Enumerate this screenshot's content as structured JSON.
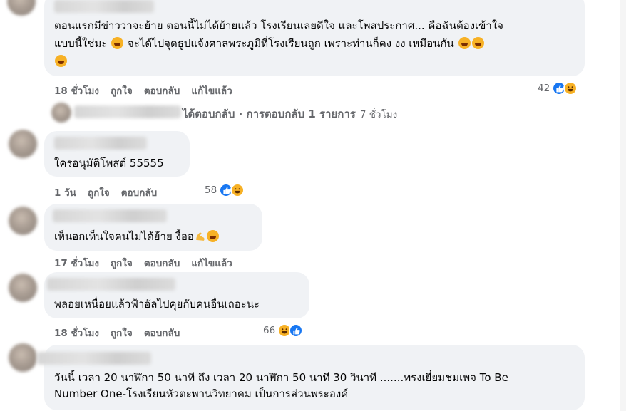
{
  "comments": [
    {
      "text_line1": "ตอนแรกมีข่าวว่าจะย้าย ตอนนี้ไม่ได้ย้ายแล้ว โรงเรียนเลยดีใจ และโพสประกาศ... คือฉันต้องเข้าใจ",
      "text_line2a": "แบบนี้ใช่มะ",
      "text_line2b": "จะได้ไปจุดธูปแจ้งศาลพระภูมิที่โรงเรียนถูก เพราะท่านก็คง งง เหมือนกัน",
      "time": "18 ชั่วโมง",
      "like": "ถูกใจ",
      "reply": "ตอบกลับ",
      "edited": "แก้ไขแล้ว",
      "reaction_count": "42"
    },
    {
      "text": "ใครอนุมัติโพสต์ 55555",
      "time": "1 วัน",
      "like": "ถูกใจ",
      "reply": "ตอบกลับ",
      "reaction_count": "58"
    },
    {
      "text": "เห็นอกเห็นใจคนไม่ได้ย้าย งื้ออ",
      "time": "17 ชั่วโมง",
      "like": "ถูกใจ",
      "reply": "ตอบกลับ",
      "edited": "แก้ไขแล้ว"
    },
    {
      "text": "พลอยเหนื่อยแล้วฟ้าอัลไปคุยกับคนอื่นเถอะนะ",
      "time": "18 ชั่วโมง",
      "like": "ถูกใจ",
      "reply": "ตอบกลับ",
      "reaction_count": "66"
    },
    {
      "text_line1": "วันนี้ เวลา 20 นาฬิกา 50 นาที ถึง เวลา 20 นาฬิกา 50 นาที 30 วินาที .......ทรงเยี่ยมชมเพจ To Be",
      "text_line2": "Number One-โรงเรียนหัวตะพานวิทยาคม เป็นการส่วนพระองค์"
    }
  ],
  "reply_summary": {
    "text": "ได้ตอบกลับ · การตอบกลับ 1 รายการ",
    "time": "7 ชั่วโมง"
  },
  "colors": {
    "bubble": "#f0f2f5",
    "meta": "#65676b",
    "like": "#1877f2",
    "haha": "#f7b125"
  }
}
